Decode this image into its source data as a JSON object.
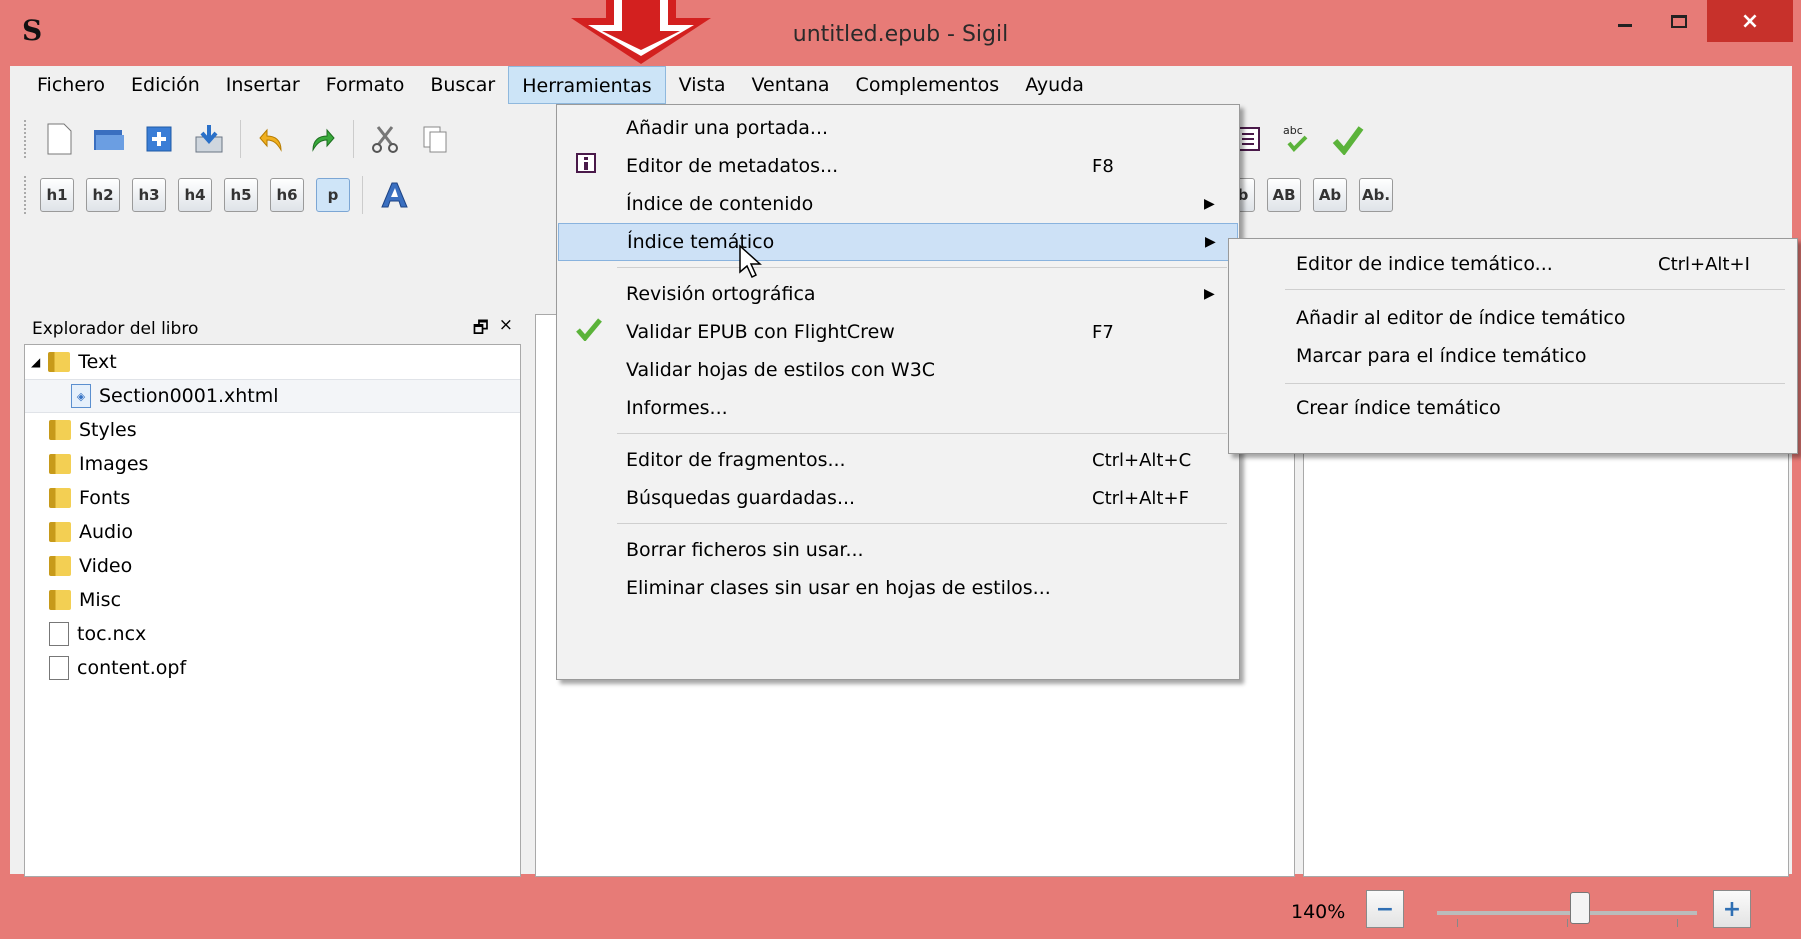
{
  "window": {
    "title": "untitled.epub - Sigil",
    "logo_glyph": "S",
    "min_glyph": "–",
    "max_glyph": "□",
    "close_glyph": "×"
  },
  "menubar": [
    "Fichero",
    "Edición",
    "Insertar",
    "Formato",
    "Buscar",
    "Herramientas",
    "Vista",
    "Ventana",
    "Complementos",
    "Ayuda"
  ],
  "toolbar": {
    "heading_buttons": [
      "h1",
      "h2",
      "h3",
      "h4",
      "h5",
      "h6",
      "p"
    ],
    "icons_top_left": [
      "new-file-icon",
      "open-folder-icon",
      "add-icon",
      "save-icon",
      "undo-icon",
      "redo-icon",
      "cut-icon",
      "copy-icon"
    ],
    "icons_top_right": [
      "heart-icon",
      "metadata-icon",
      "toc-icon",
      "spellcheck-icon",
      "validate-icon"
    ],
    "icons_second_right": [
      "outdent-icon",
      "indent-icon"
    ],
    "case_buttons": [
      "ab",
      "AB",
      "Ab",
      "Ab."
    ]
  },
  "book_browser": {
    "title": "Explorador del libro",
    "float_glyph": "🗗",
    "close_glyph": "×",
    "items": [
      {
        "label": "Text",
        "kind": "folder",
        "expanded": true
      },
      {
        "label": "Section0001.xhtml",
        "kind": "xhtml"
      },
      {
        "label": "Styles",
        "kind": "folder"
      },
      {
        "label": "Images",
        "kind": "folder"
      },
      {
        "label": "Fonts",
        "kind": "folder"
      },
      {
        "label": "Audio",
        "kind": "folder"
      },
      {
        "label": "Video",
        "kind": "folder"
      },
      {
        "label": "Misc",
        "kind": "folder"
      },
      {
        "label": "toc.ncx",
        "kind": "file"
      },
      {
        "label": "content.opf",
        "kind": "file"
      }
    ]
  },
  "tools_menu": [
    {
      "label": "Añadir una portada...",
      "shortcut": "",
      "submenu": false
    },
    {
      "label": "Editor de metadatos...",
      "shortcut": "F8",
      "submenu": false,
      "icon": "metadata-icon"
    },
    {
      "label": "Índice de contenido",
      "shortcut": "",
      "submenu": true
    },
    {
      "label": "Índice temático",
      "shortcut": "",
      "submenu": true,
      "highlighted": true
    },
    {
      "label": "Revisión ortográfica",
      "shortcut": "",
      "submenu": true
    },
    {
      "label": "Validar EPUB con FlightCrew",
      "shortcut": "F7",
      "submenu": false,
      "icon": "check-icon"
    },
    {
      "label": "Validar hojas de estilos con W3C",
      "shortcut": "",
      "submenu": false
    },
    {
      "label": "Informes...",
      "shortcut": "",
      "submenu": false
    },
    {
      "label": "Editor de fragmentos...",
      "shortcut": "Ctrl+Alt+C",
      "submenu": false
    },
    {
      "label": "Búsquedas guardadas...",
      "shortcut": "Ctrl+Alt+F",
      "submenu": false
    },
    {
      "label": "Borrar ficheros sin usar...",
      "shortcut": "",
      "submenu": false
    },
    {
      "label": "Eliminar clases sin usar en hojas de estilos...",
      "shortcut": "",
      "submenu": false
    }
  ],
  "index_submenu": [
    {
      "label": "Editor de indice temático...",
      "shortcut": "Ctrl+Alt+I"
    },
    {
      "label": "Añadir al editor de índice temático",
      "shortcut": ""
    },
    {
      "label": "Marcar para el índice temático",
      "shortcut": ""
    },
    {
      "label": "Crear índice temático",
      "shortcut": ""
    }
  ],
  "status": {
    "zoom": "140%",
    "zoom_level": 0.55,
    "zoom_out_glyph": "−",
    "zoom_in_glyph": "+"
  },
  "colors": {
    "title_bar": "#e77b77",
    "close_button": "#c7312b",
    "menu_highlight": "#cde1f6",
    "arrow": "#d3201f"
  }
}
